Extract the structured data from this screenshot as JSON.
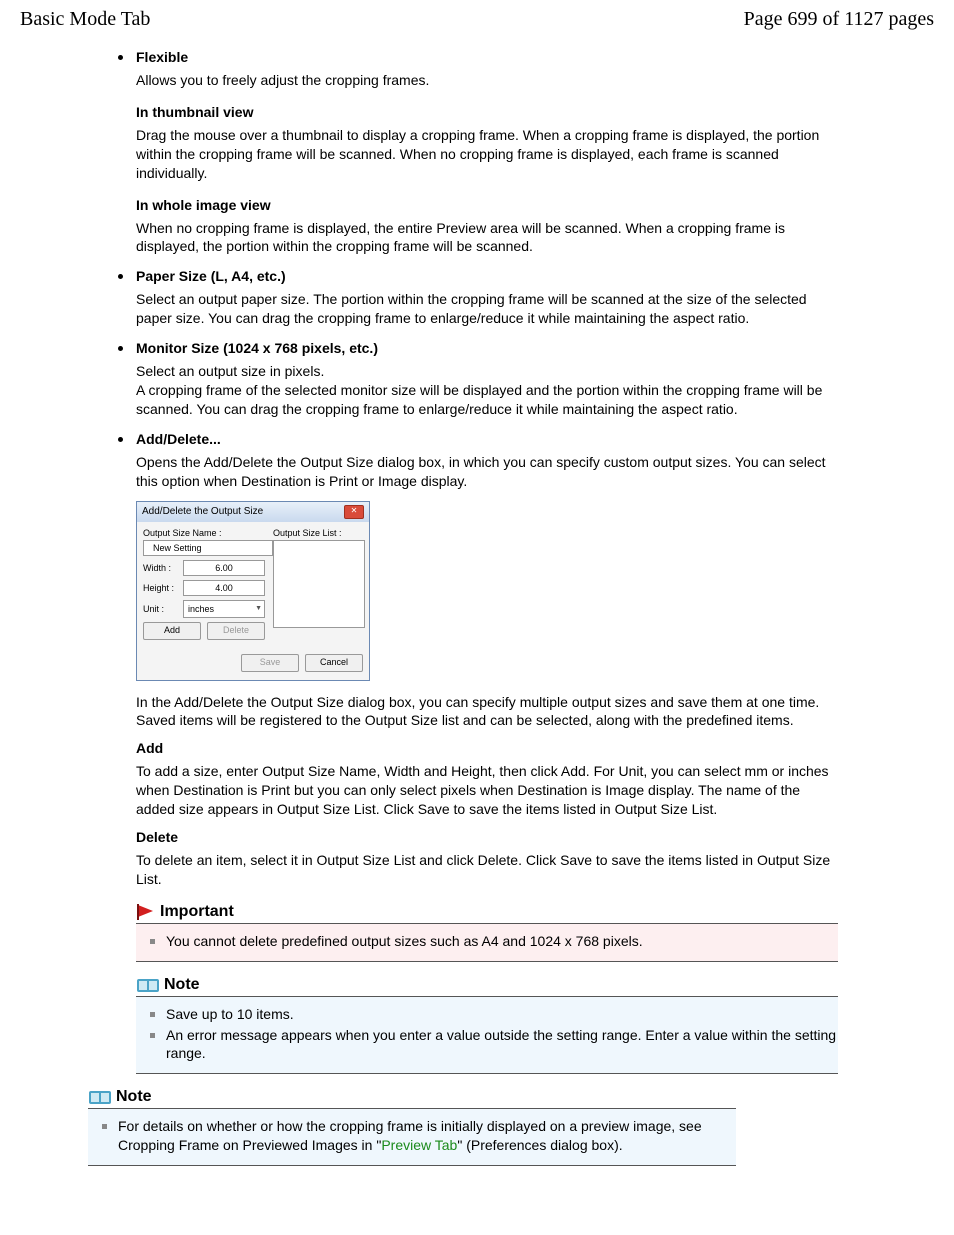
{
  "header": {
    "title": "Basic Mode Tab",
    "page_label": "Page 699 of 1127 pages"
  },
  "flexible": {
    "title": "Flexible",
    "desc": "Allows you to freely adjust the cropping frames.",
    "thumb_head": "In thumbnail view",
    "thumb_body": "Drag the mouse over a thumbnail to display a cropping frame. When a cropping frame is displayed, the portion within the cropping frame will be scanned. When no cropping frame is displayed, each frame is scanned individually.",
    "whole_head": "In whole image view",
    "whole_body": "When no cropping frame is displayed, the entire Preview area will be scanned. When a cropping frame is displayed, the portion within the cropping frame will be scanned."
  },
  "paper": {
    "title": "Paper Size (L, A4, etc.)",
    "body": "Select an output paper size. The portion within the cropping frame will be scanned at the size of the selected paper size. You can drag the cropping frame to enlarge/reduce it while maintaining the aspect ratio."
  },
  "monitor": {
    "title": "Monitor Size (1024 x 768 pixels, etc.)",
    "body1": "Select an output size in pixels.",
    "body2": "A cropping frame of the selected monitor size will be displayed and the portion within the cropping frame will be scanned. You can drag the cropping frame to enlarge/reduce it while maintaining the aspect ratio."
  },
  "adddelete": {
    "title": "Add/Delete...",
    "intro": "Opens the Add/Delete the Output Size dialog box, in which you can specify custom output sizes. You can select this option when Destination is Print or Image display.",
    "after_dialog": "In the Add/Delete the Output Size dialog box, you can specify multiple output sizes and save them at one time. Saved items will be registered to the Output Size list and can be selected, along with the predefined items.",
    "add_head": "Add",
    "add_body": "To add a size, enter Output Size Name, Width and Height, then click Add. For Unit, you can select mm or inches when Destination is Print but you can only select pixels when Destination is Image display. The name of the added size appears in Output Size List. Click Save to save the items listed in Output Size List.",
    "del_head": "Delete",
    "del_body": "To delete an item, select it in Output Size List and click Delete. Click Save to save the items listed in Output Size List."
  },
  "dialog": {
    "title": "Add/Delete the Output Size",
    "name_label": "Output Size Name :",
    "name_value": "New Setting",
    "width_label": "Width :",
    "width_value": "6.00",
    "height_label": "Height :",
    "height_value": "4.00",
    "unit_label": "Unit :",
    "unit_value": "inches",
    "list_label": "Output Size List :",
    "add_btn": "Add",
    "delete_btn": "Delete",
    "save_btn": "Save",
    "cancel_btn": "Cancel"
  },
  "important": {
    "title": "Important",
    "item1": "You cannot delete predefined output sizes such as A4 and 1024 x 768 pixels."
  },
  "note1": {
    "title": "Note",
    "item1": "Save up to 10 items.",
    "item2": "An error message appears when you enter a value outside the setting range. Enter a value within the setting range."
  },
  "note2": {
    "title": "Note",
    "item1_pre": "For details on whether or how the cropping frame is initially displayed on a preview image, see Cropping Frame on Previewed Images in \"",
    "item1_link": "Preview Tab",
    "item1_post": "\" (Preferences dialog box)."
  }
}
